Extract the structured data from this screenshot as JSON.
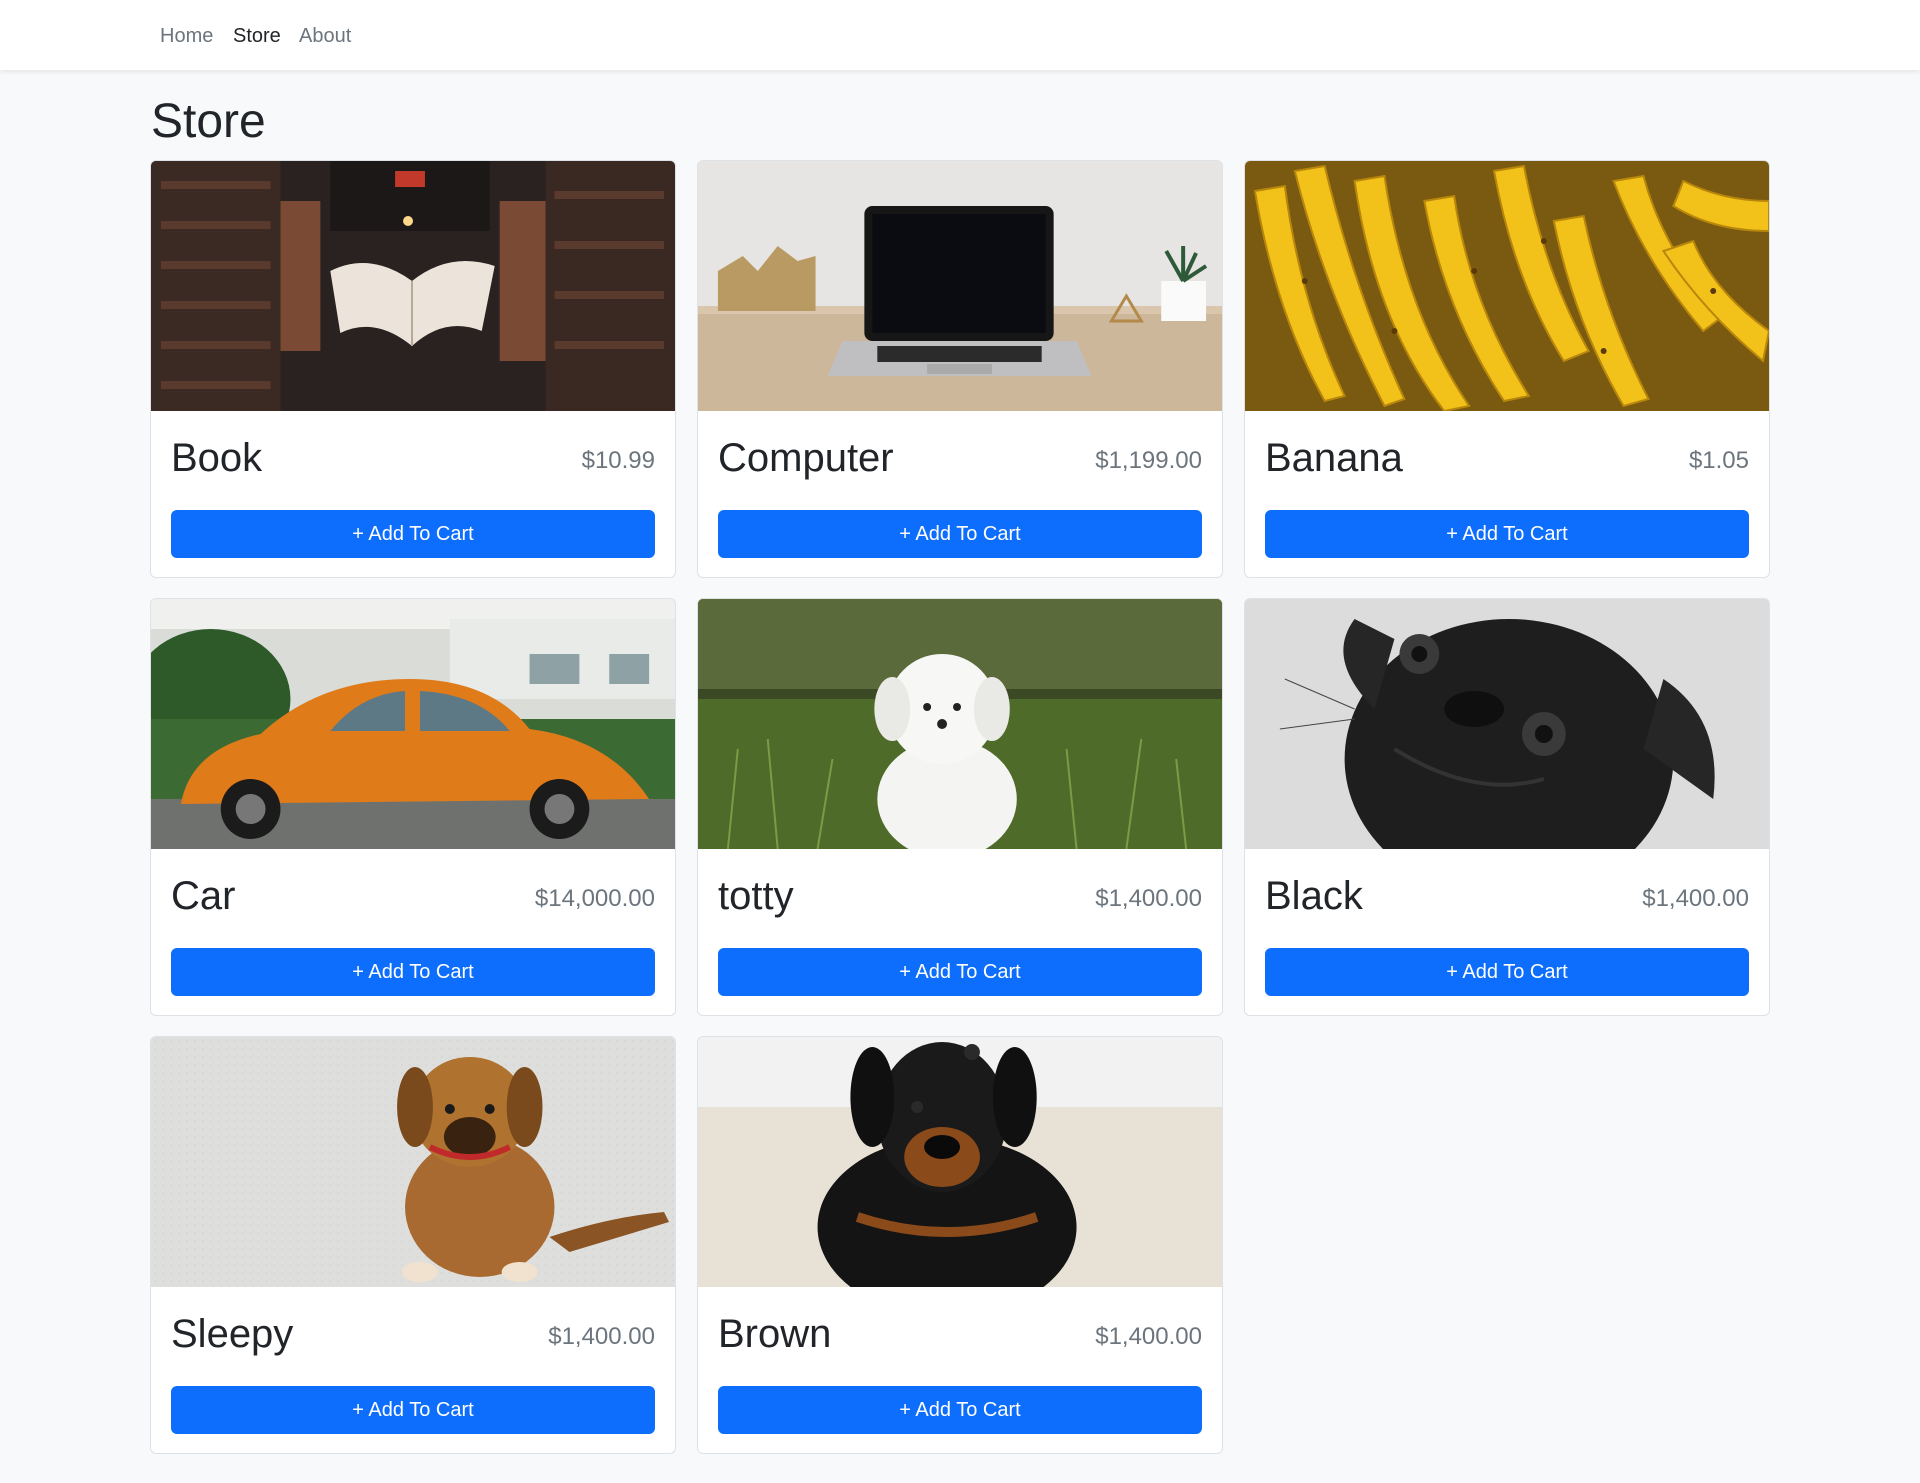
{
  "nav": {
    "links": [
      {
        "label": "Home"
      },
      {
        "label": "Store"
      },
      {
        "label": "About"
      }
    ]
  },
  "page": {
    "title": "Store"
  },
  "products": [
    {
      "name": "Book",
      "price": "$10.99",
      "button": "+ Add To Cart",
      "image": "flying-book-library-photo"
    },
    {
      "name": "Computer",
      "price": "$1,199.00",
      "button": "+ Add To Cart",
      "image": "laptop-on-desk-photo"
    },
    {
      "name": "Banana",
      "price": "$1.05",
      "button": "+ Add To Cart",
      "image": "bananas-photo"
    },
    {
      "name": "Car",
      "price": "$14,000.00",
      "button": "+ Add To Cart",
      "image": "orange-beetle-car-photo"
    },
    {
      "name": "totty",
      "price": "$1,400.00",
      "button": "+ Add To Cart",
      "image": "white-puppy-grass-photo"
    },
    {
      "name": "Black",
      "price": "$1,400.00",
      "button": "+ Add To Cart",
      "image": "black-pug-photo"
    },
    {
      "name": "Sleepy",
      "price": "$1,400.00",
      "button": "+ Add To Cart",
      "image": "brown-puppy-photo"
    },
    {
      "name": "Brown",
      "price": "$1,400.00",
      "button": "+ Add To Cart",
      "image": "rottweiler-puppy-photo"
    }
  ],
  "colors": {
    "primary": "#0d6efd",
    "muted": "#6c757d",
    "background": "#f8f9fa"
  }
}
